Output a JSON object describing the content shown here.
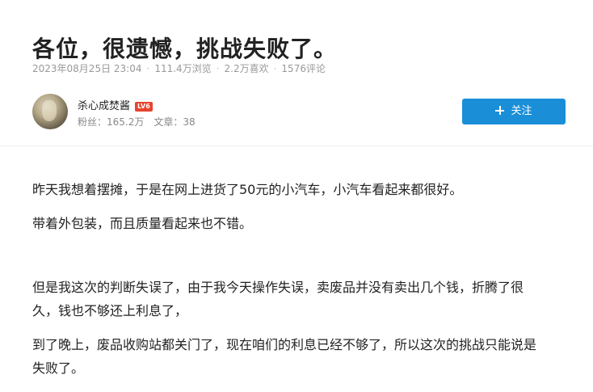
{
  "article": {
    "title": "各位，很遗憾，挑战失败了。",
    "meta": {
      "date": "2023年08月25日 23:04",
      "views": "111.4万浏览",
      "likes": "2.2万喜欢",
      "comments": "1576评论",
      "separator": "·"
    }
  },
  "author": {
    "name": "杀心成焚酱",
    "level": "LV6",
    "fans": "粉丝：165.2万",
    "posts": "文章：38",
    "avatar_icon": "avatar-image"
  },
  "follow_button": {
    "label": "关注",
    "icon": "plus-icon",
    "color": "#1a8fd8"
  },
  "body": {
    "paragraphs": [
      "昨天我想着摆摊，于是在网上进货了50元的小汽车，小汽车看起来都很好。",
      "带着外包装，而且质量看起来也不错。",
      "但是我这次的判断失误了，由于我今天操作失误，卖废品并没有卖出几个钱，折腾了很久，钱也不够还上利息了，",
      "到了晚上，废品收购站都关门了，现在咱们的利息已经不够了，所以这次的挑战只能说是失败了。"
    ]
  }
}
